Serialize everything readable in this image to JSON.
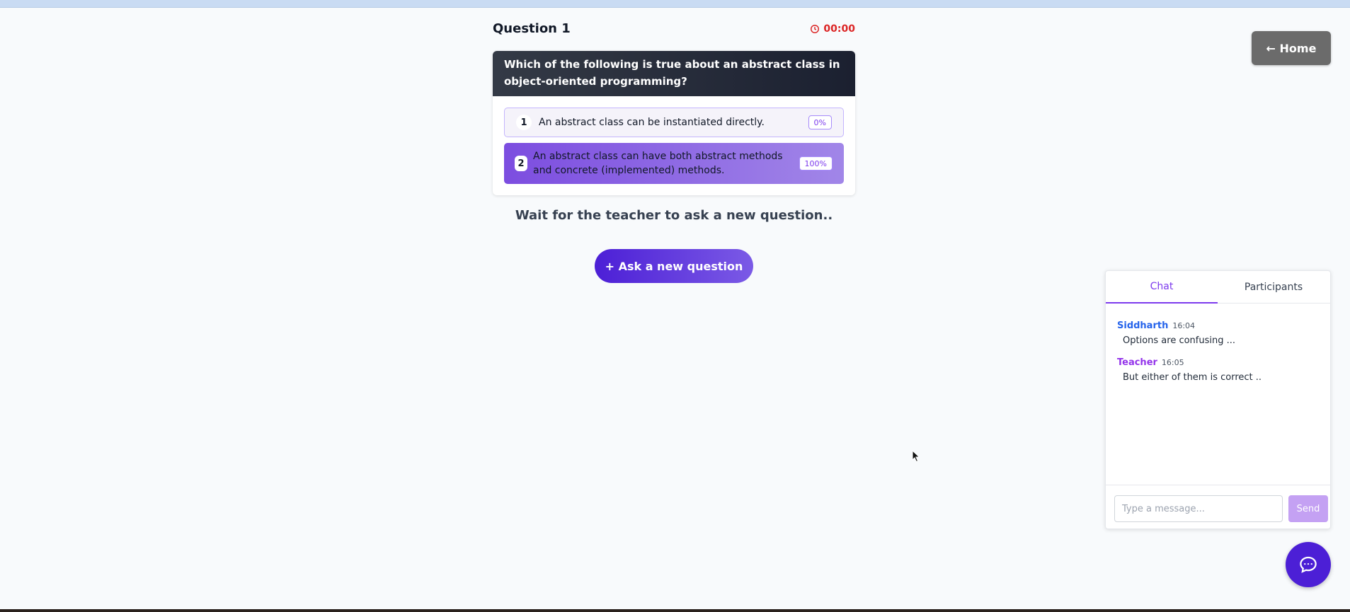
{
  "home_button": {
    "label": "← Home"
  },
  "question": {
    "title": "Question 1",
    "timer": "00:00",
    "text": "Which of the following is true about an abstract class in object-oriented programming?",
    "options": [
      {
        "number": "1",
        "text": "An abstract class can be instantiated directly.",
        "percent": "0%"
      },
      {
        "number": "2",
        "text": "An abstract class can have both abstract methods and concrete (implemented) methods.",
        "percent": "100%"
      }
    ]
  },
  "wait_message": "Wait for the teacher to ask a new question..",
  "ask_button": {
    "label": "+ Ask a new question"
  },
  "chat_panel": {
    "tabs": [
      {
        "label": "Chat",
        "active": true
      },
      {
        "label": "Participants",
        "active": false
      }
    ],
    "messages": [
      {
        "author": "Siddharth",
        "time": "16:04",
        "text": "Options are confusing ..."
      },
      {
        "author": "Teacher",
        "time": "16:05",
        "text": "But either of them is correct .."
      }
    ],
    "input": {
      "placeholder": "Type a message...",
      "value": ""
    },
    "send_label": "Send"
  },
  "icons": {
    "timer": "clock-icon",
    "fab": "chat-bubble-icon"
  },
  "colors": {
    "accent": "#4c1fd6",
    "accent_light": "#7c3aed",
    "timer": "#dc2626",
    "teacher": "#9333ea",
    "student": "#2563eb"
  }
}
